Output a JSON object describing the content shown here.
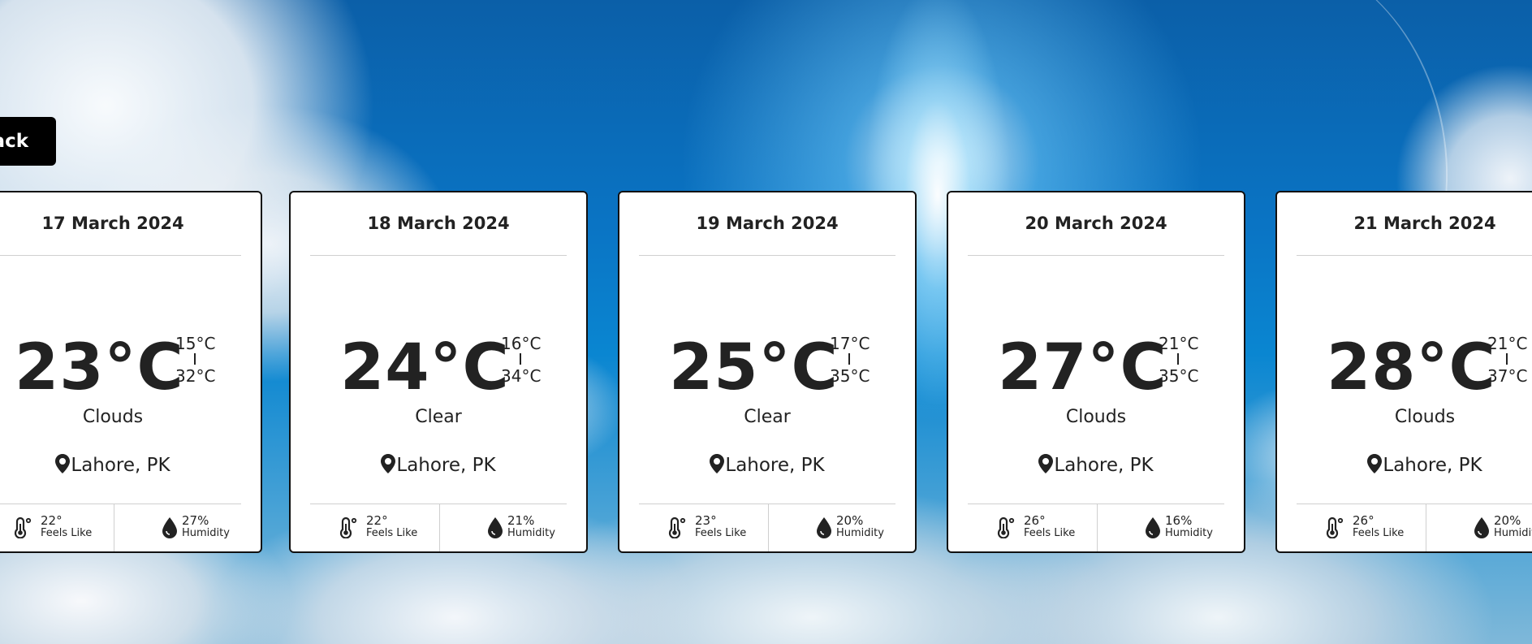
{
  "back_button": {
    "label": "Back"
  },
  "cards": [
    {
      "date": "17 March 2024",
      "temp": "23°C",
      "min": "15°C",
      "max": "32°C",
      "condition": "Clouds",
      "location": "Lahore, PK",
      "feels_like": "22°",
      "feels_like_label": "Feels Like",
      "humidity": "27%",
      "humidity_label": "Humidity"
    },
    {
      "date": "18 March 2024",
      "temp": "24°C",
      "min": "16°C",
      "max": "34°C",
      "condition": "Clear",
      "location": "Lahore, PK",
      "feels_like": "22°",
      "feels_like_label": "Feels Like",
      "humidity": "21%",
      "humidity_label": "Humidity"
    },
    {
      "date": "19 March 2024",
      "temp": "25°C",
      "min": "17°C",
      "max": "35°C",
      "condition": "Clear",
      "location": "Lahore, PK",
      "feels_like": "23°",
      "feels_like_label": "Feels Like",
      "humidity": "20%",
      "humidity_label": "Humidity"
    },
    {
      "date": "20 March 2024",
      "temp": "27°C",
      "min": "21°C",
      "max": "35°C",
      "condition": "Clouds",
      "location": "Lahore, PK",
      "feels_like": "26°",
      "feels_like_label": "Feels Like",
      "humidity": "16%",
      "humidity_label": "Humidity"
    },
    {
      "date": "21 March 2024",
      "temp": "28°C",
      "min": "21°C",
      "max": "37°C",
      "condition": "Clouds",
      "location": "Lahore, PK",
      "feels_like": "26°",
      "feels_like_label": "Feels Like",
      "humidity": "20%",
      "humidity_label": "Humidity"
    }
  ],
  "icons": {
    "location": "map-pin-icon",
    "feels_like": "thermometer-icon",
    "humidity": "water-drop-icon"
  }
}
